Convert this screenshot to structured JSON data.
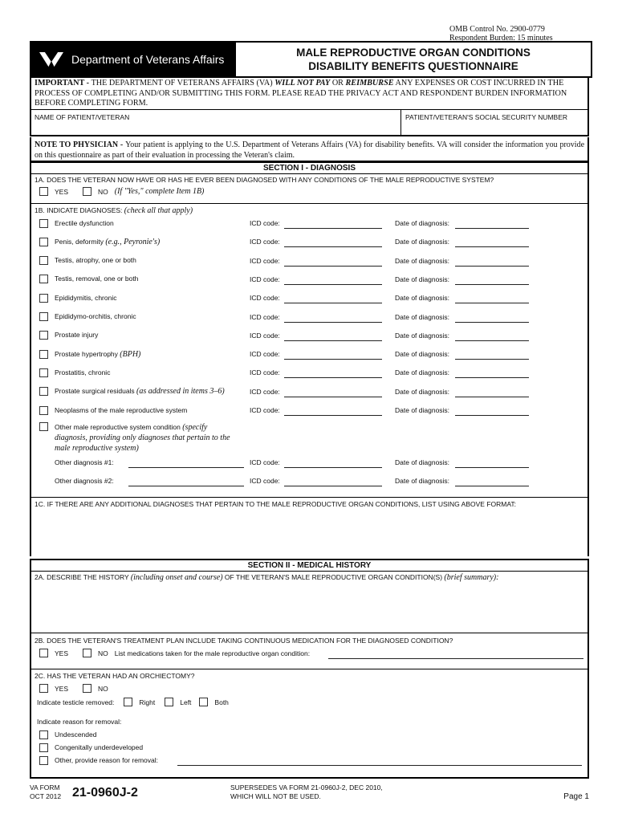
{
  "omb": {
    "control": "OMB Control No. 2900-0779",
    "burden": "Respondent Burden: 15 minutes"
  },
  "header": {
    "agency": "Department of Veterans Affairs",
    "logo_icon": "va-logo-icon",
    "title_line1": "MALE REPRODUCTIVE ORGAN CONDITIONS",
    "title_line2": "DISABILITY BENEFITS QUESTIONNAIRE"
  },
  "important": {
    "lead": "IMPORTANT - ",
    "text1": "THE DEPARTMENT OF VETERANS AFFAIRS (VA) ",
    "will_not_pay": "WILL NOT PAY",
    "or": " OR ",
    "reimburse": "REIMBURSE",
    "text2": " ANY EXPENSES OR COST INCURRED IN THE PROCESS OF COMPLETING AND/OR SUBMITTING THIS FORM. PLEASE READ THE PRIVACY ACT AND RESPONDENT BURDEN INFORMATION BEFORE COMPLETING FORM."
  },
  "patient": {
    "name_label": "NAME OF PATIENT/VETERAN",
    "name_value": "",
    "ssn_label": "PATIENT/VETERAN'S SOCIAL SECURITY NUMBER",
    "ssn_value": ""
  },
  "note": {
    "lead": "NOTE TO PHYSICIAN - ",
    "text": "Your patient is applying to the U.S. Department of Veterans Affairs (VA) for disability benefits. VA will consider the information you provide on this questionnaire as part of their evaluation in processing the Veteran's claim."
  },
  "section1": {
    "title": "SECTION I - DIAGNOSIS",
    "q1a": "1A. DOES THE VETERAN NOW HAVE OR HAS HE EVER BEEN DIAGNOSED WITH ANY CONDITIONS OF THE MALE REPRODUCTIVE SYSTEM?",
    "yes": "YES",
    "no": "NO",
    "q1a_hint": "(If \"Yes,\" complete Item 1B)",
    "q1b": "1B. INDICATE DIAGNOSES: ",
    "q1b_hint": "(check all that apply)",
    "icd_label": "ICD code:",
    "date_label": "Date of diagnosis:",
    "diagnoses": [
      {
        "label": "Erectile dysfunction",
        "hint": ""
      },
      {
        "label": "Penis, deformity ",
        "hint": "(e.g., Peyronie's)"
      },
      {
        "label": "Testis, atrophy, one or both",
        "hint": ""
      },
      {
        "label": "Testis, removal, one or both",
        "hint": ""
      },
      {
        "label": "Epididymitis, chronic",
        "hint": ""
      },
      {
        "label": "Epididymo-orchitis, chronic",
        "hint": ""
      },
      {
        "label": "Prostate injury",
        "hint": ""
      },
      {
        "label": "Prostate hypertrophy ",
        "hint": "(BPH)"
      },
      {
        "label": "Prostatitis, chronic",
        "hint": ""
      },
      {
        "label": "Prostate surgical residuals ",
        "hint": "(as addressed in items 3–6)"
      },
      {
        "label": "Neoplasms of the male reproductive system",
        "hint": ""
      }
    ],
    "other_label": "Other male reproductive system condition ",
    "other_hint": "(specify diagnosis, providing only diagnoses that pertain to the male reproductive system)",
    "other1": "Other diagnosis #1:",
    "other2": "Other diagnosis #2:",
    "q1c": "1C. IF THERE ARE ANY ADDITIONAL DIAGNOSES THAT PERTAIN TO THE MALE REPRODUCTIVE ORGAN CONDITIONS, LIST USING ABOVE FORMAT:"
  },
  "section2": {
    "title": "SECTION II - MEDICAL HISTORY",
    "q2a_a": "2A. DESCRIBE THE HISTORY ",
    "q2a_b": "(including onset and course)",
    "q2a_c": " OF THE VETERAN'S MALE REPRODUCTIVE ORGAN CONDITION(S) ",
    "q2a_d": "(brief summary):",
    "q2b": "2B. DOES THE VETERAN'S TREATMENT PLAN INCLUDE TAKING CONTINUOUS MEDICATION FOR THE DIAGNOSED CONDITION?",
    "yes": "YES",
    "no": "NO",
    "meds_label": "List medications taken for the male reproductive organ condition:",
    "q2c": "2C. HAS THE VETERAN HAD AN ORCHIECTOMY?",
    "testicle_label": "Indicate testicle removed:",
    "right": "Right",
    "left": "Left",
    "both": "Both",
    "reason_label": "Indicate reason for removal:",
    "reasons": [
      "Undescended",
      "Congenitally underdeveloped",
      "Other, provide reason for removal:"
    ]
  },
  "footer": {
    "va_form": "VA FORM",
    "date": "OCT 2012",
    "form_number": "21-0960J-2",
    "supersedes1": "SUPERSEDES VA FORM 21-0960J-2, DEC 2010,",
    "supersedes2": "WHICH WILL NOT BE USED.",
    "page": "Page 1"
  }
}
